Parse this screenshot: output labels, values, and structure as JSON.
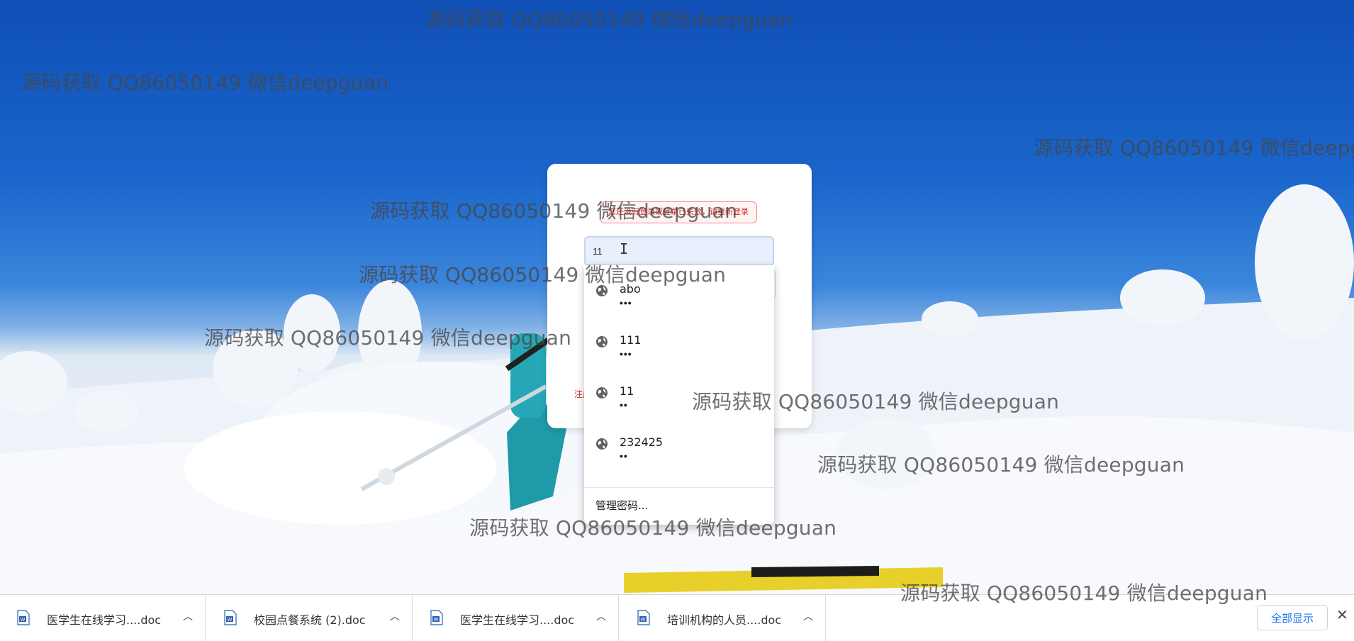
{
  "login": {
    "notice": "您还没有登录或登录已失效，请重新登录",
    "register_link": "注册",
    "username_value": "11"
  },
  "autofill": {
    "entries": [
      {
        "user": "abo",
        "pass": "•••"
      },
      {
        "user": "111",
        "pass": "•••"
      },
      {
        "user": "11",
        "pass": "••"
      },
      {
        "user": "232425",
        "pass": "••"
      }
    ],
    "manage": "管理密码..."
  },
  "watermark": {
    "text": "源码获取 QQ86050149 微信deepguan"
  },
  "downloads": {
    "items": [
      {
        "name": "医学生在线学习....doc"
      },
      {
        "name": "校园点餐系统 (2).doc"
      },
      {
        "name": "医学生在线学习....doc"
      },
      {
        "name": "培训机构的人员....doc"
      }
    ],
    "show_all": "全部显示",
    "close": "✕"
  },
  "icons": {
    "entry": "globe-icon",
    "file": "word-doc-icon",
    "chevron": "chevron-up-icon"
  },
  "colors": {
    "sky": "#1a66cc",
    "notice_red": "#d32b2b",
    "autofill_bg": "#e8f0fe",
    "link_blue": "#1a73e8"
  }
}
